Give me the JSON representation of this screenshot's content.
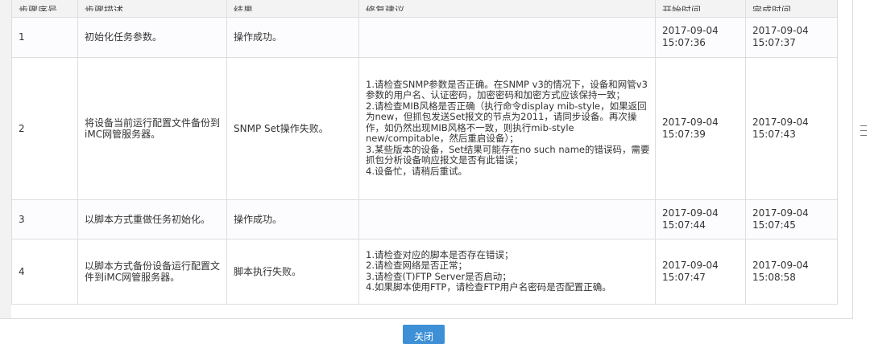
{
  "table": {
    "headers": {
      "step_no": "步骤序号",
      "step_desc": "步骤描述",
      "result": "结果",
      "suggestion": "修复建议",
      "start_time": "开始时间",
      "end_time": "完成时间"
    },
    "rows": [
      {
        "no": "1",
        "desc": "初始化任务参数。",
        "result": "操作成功。",
        "suggestion": [],
        "start_date": "2017-09-04",
        "start_time": "15:07:36",
        "end_date": "2017-09-04",
        "end_time": "15:07:37"
      },
      {
        "no": "2",
        "desc": "将设备当前运行配置文件备份到iMC网管服务器。",
        "result": "SNMP Set操作失败。",
        "suggestion": [
          "1.请检查SNMP参数是否正确。在SNMP v3的情况下，设备和网管v3参数的用户名、认证密码，加密密码和加密方式应该保持一致；",
          "2.请检查MIB风格是否正确（执行命令display mib-style，如果返回为new，但抓包发送Set报文的节点为2011，请同步设备。再次操作，如仍然出现MIB风格不一致，则执行mib-style new/compitable，然后重启设备）；",
          "3.某些版本的设备，Set结果可能存在no such name的错误码，需要抓包分析设备响应报文是否有此错误；",
          "4.设备忙，请稍后重试。"
        ],
        "start_date": "2017-09-04",
        "start_time": "15:07:39",
        "end_date": "2017-09-04",
        "end_time": "15:07:43"
      },
      {
        "no": "3",
        "desc": "以脚本方式重做任务初始化。",
        "result": "操作成功。",
        "suggestion": [],
        "start_date": "2017-09-04",
        "start_time": "15:07:44",
        "end_date": "2017-09-04",
        "end_time": "15:07:45"
      },
      {
        "no": "4",
        "desc": "以脚本方式备份设备运行配置文件到iMC网管服务器。",
        "result": "脚本执行失败。",
        "suggestion": [
          "1.请检查对应的脚本是否存在错误；",
          "2.请检查网络是否正常；",
          "3.请检查(T)FTP Server是否启动；",
          "4.如果脚本使用FTP，请检查FTP用户名密码是否配置正确。"
        ],
        "start_date": "2017-09-04",
        "start_time": "15:07:47",
        "end_date": "2017-09-04",
        "end_time": "15:08:58"
      }
    ]
  },
  "footer": {
    "close_label": "关闭"
  },
  "colors": {
    "button": "#3d8fd6",
    "header_bg": "#f3f3f3",
    "border": "#dedede"
  },
  "icons": {
    "scroll_grip": "grip-lines-icon"
  }
}
